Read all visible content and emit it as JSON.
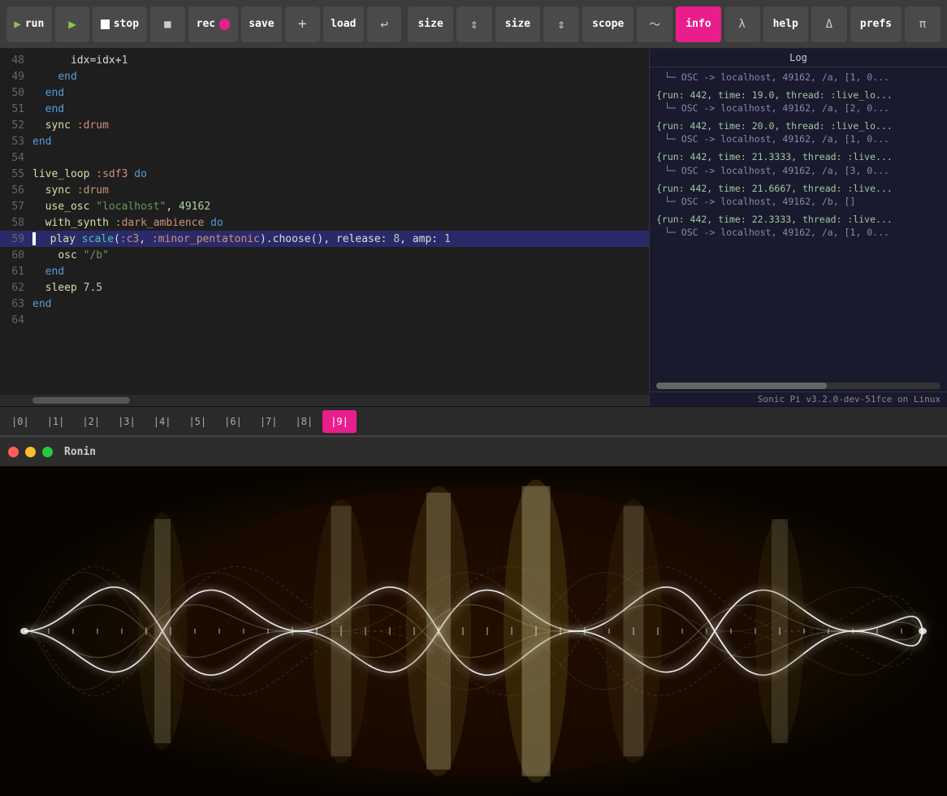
{
  "toolbar": {
    "run_label": "run",
    "stop_label": "stop",
    "rec_label": "rec",
    "save_label": "save",
    "load_label": "load",
    "size_label1": "size",
    "size_label2": "size",
    "scope_label": "scope",
    "info_label": "info",
    "help_label": "help",
    "prefs_label": "prefs"
  },
  "editor": {
    "lines": [
      {
        "num": "48",
        "code": "      idx=idx+1",
        "highlight": false
      },
      {
        "num": "49",
        "code": "    end",
        "highlight": false
      },
      {
        "num": "50",
        "code": "  end",
        "highlight": false
      },
      {
        "num": "51",
        "code": "  end",
        "highlight": false
      },
      {
        "num": "52",
        "code": "  sync :drum",
        "highlight": false
      },
      {
        "num": "53",
        "code": "end",
        "highlight": false
      },
      {
        "num": "54",
        "code": "",
        "highlight": false
      },
      {
        "num": "55",
        "code": "live_loop :sdf3 do",
        "highlight": false
      },
      {
        "num": "56",
        "code": "  sync :drum",
        "highlight": false
      },
      {
        "num": "57",
        "code": "  use_osc \"localhost\", 49162",
        "highlight": false
      },
      {
        "num": "58",
        "code": "  with_synth :dark_ambience do",
        "highlight": false
      },
      {
        "num": "59",
        "code": "  | play scale(:c3, :minor_pentatonic).choose(), release: 8, amp: 1",
        "highlight": true
      },
      {
        "num": "60",
        "code": "    osc \"/b\"",
        "highlight": false
      },
      {
        "num": "61",
        "code": "  end",
        "highlight": false
      },
      {
        "num": "62",
        "code": "  sleep 7.5",
        "highlight": false
      },
      {
        "num": "63",
        "code": "end",
        "highlight": false
      },
      {
        "num": "64",
        "code": "",
        "highlight": false
      }
    ]
  },
  "tabs": [
    {
      "label": "|0|",
      "active": false
    },
    {
      "label": "|1|",
      "active": false
    },
    {
      "label": "|2|",
      "active": false
    },
    {
      "label": "|3|",
      "active": false
    },
    {
      "label": "|4|",
      "active": false
    },
    {
      "label": "|5|",
      "active": false
    },
    {
      "label": "|6|",
      "active": false
    },
    {
      "label": "|7|",
      "active": false
    },
    {
      "label": "|8|",
      "active": false
    },
    {
      "label": "|9|",
      "active": true
    }
  ],
  "log": {
    "title": "Log",
    "entries": [
      {
        "line1": "└─ OSC -> localhost, 49162, /a, [1, 0...",
        "line2": ""
      },
      {
        "line1": "{run: 442, time: 19.0, thread: :live_lo...",
        "line2": "└─ OSC -> localhost, 49162, /a, [2, 0..."
      },
      {
        "line1": "{run: 442, time: 20.0, thread: :live_lo...",
        "line2": "└─ OSC -> localhost, 49162, /a, [1, 0..."
      },
      {
        "line1": "{run: 442, time: 21.3333, thread: :live...",
        "line2": "└─ OSC -> localhost, 49162, /a, [3, 0..."
      },
      {
        "line1": "{run: 442, time: 21.6667, thread: :live...",
        "line2": "└─ OSC -> localhost, 49162, /b, []"
      },
      {
        "line1": "{run: 442, time: 22.3333, thread: :live...",
        "line2": "└─ OSC -> localhost, 49162, /a, [1, 0..."
      }
    ]
  },
  "status_bar": {
    "text": "Sonic Pi v3.2.0-dev-51fce on Linux"
  },
  "ronin": {
    "title": "Ronin",
    "dot_close": "●",
    "dot_min": "●",
    "dot_max": "●"
  }
}
